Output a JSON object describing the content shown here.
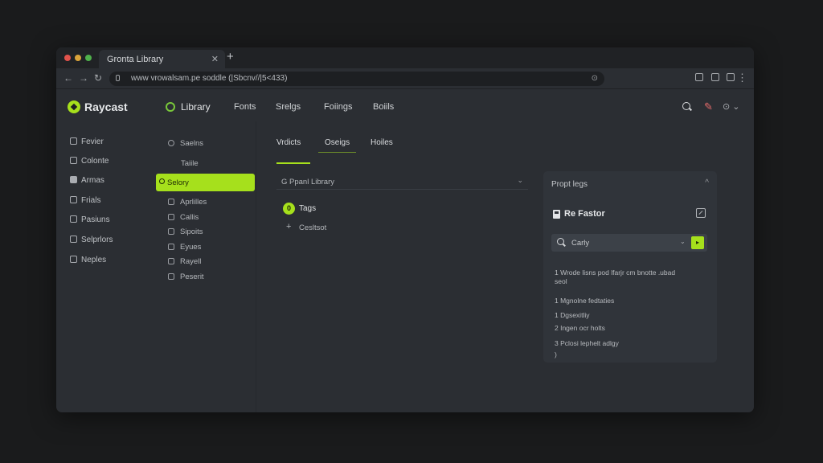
{
  "browser": {
    "tab_title": "Gronta Library",
    "tab_close": "✕",
    "new_tab": "+",
    "url": "www vrowalsam.pe soddle (|Sbcnv//|5<433)",
    "nav_back": "←",
    "nav_forward": "→",
    "nav_reload": "↻",
    "url_info": "⊙",
    "menu": "⋮"
  },
  "app": {
    "name": "Raycast",
    "header_nav": [
      "Library",
      "Fonts",
      "Srelgs",
      "Foiings",
      "Boiils"
    ]
  },
  "sidebar": {
    "items": [
      "Fevier",
      "Colonte",
      "Armas",
      "Frials",
      "Pasiuns",
      "Selprlors",
      "Neples"
    ]
  },
  "secondary": {
    "items_top": [
      "Saelns",
      "Taiile"
    ],
    "active": "Selory",
    "items_bottom": [
      "Aprlilles",
      "Callis",
      "Sipoits",
      "Eyues",
      "Rayell",
      "Peserit"
    ]
  },
  "main": {
    "tabs": [
      "Vrdicts",
      "Oseigs",
      "Hoiles"
    ],
    "dropdown_label": "G Ppanl Library",
    "dropdown_caret": "⌄",
    "tags_badge": "0",
    "tags_label": "Tags",
    "add_label": "Cesltsot"
  },
  "panel": {
    "title": "Propt legs",
    "caret": "^",
    "heading": "Re Fastor",
    "search_value": "Carly",
    "search_caret": "⌄",
    "go_label": "▸",
    "lines": [
      "1  Wrode lisns pod lfarjr cm bnotte .ubad",
      "   seol",
      "1  Mgnolne fedtaties",
      "     1   Dgsexitliy",
      "     2   Ingen ocr holts",
      "     3   Pclosi lephelt adlgy",
      "     )"
    ]
  },
  "colors": {
    "accent": "#a6e01c",
    "window_bg": "#2b2e33",
    "panel_bg": "#30343a"
  }
}
